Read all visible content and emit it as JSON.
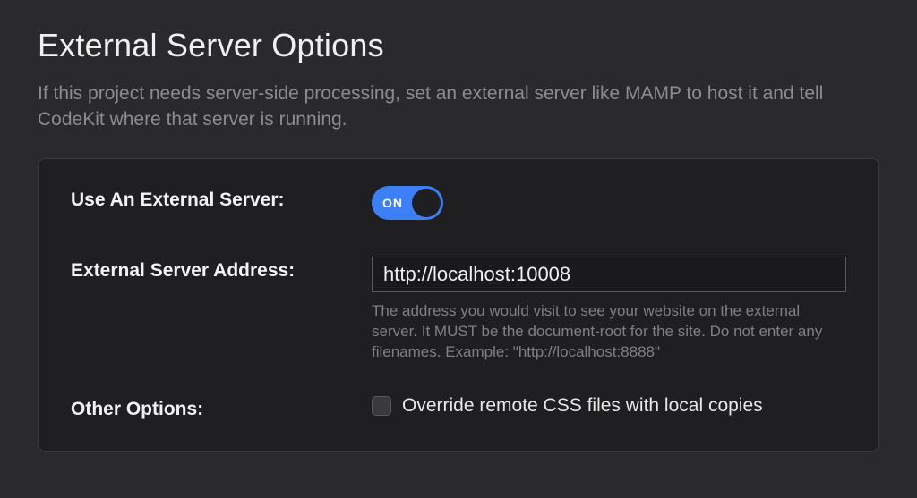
{
  "header": {
    "title": "External Server Options",
    "description": "If this project needs server-side processing, set an external server like MAMP to host it and tell CodeKit where that server is running."
  },
  "panel": {
    "use_external": {
      "label": "Use An External Server:",
      "toggle_state": "ON",
      "enabled": true
    },
    "address": {
      "label": "External Server Address:",
      "value": "http://localhost:10008",
      "help": "The address you would visit to see your website on the external server. It MUST be the document-root for the site. Do not enter any filenames. Example: \"http://localhost:8888\""
    },
    "other": {
      "label": "Other Options:",
      "checkbox_label": "Override remote CSS files with local copies",
      "checked": false
    }
  }
}
